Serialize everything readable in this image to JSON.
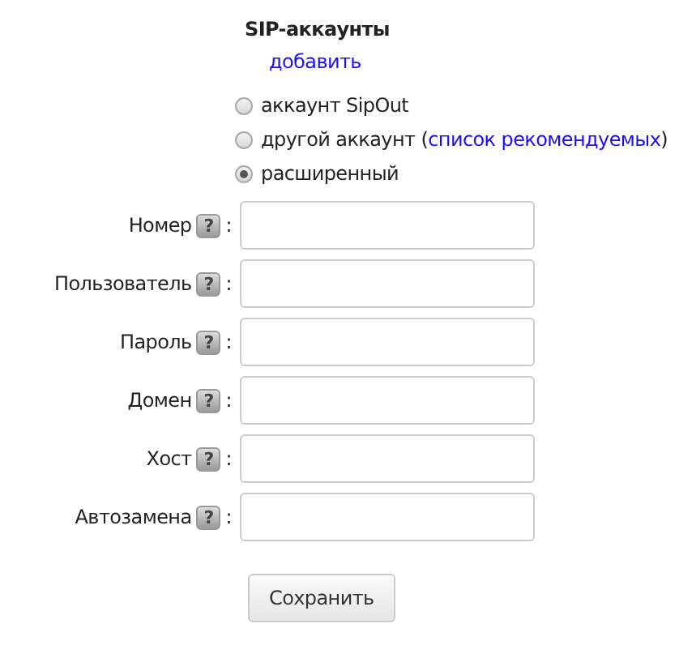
{
  "title": "SIP-аккаунты",
  "add_link": "добавить",
  "account_types": [
    {
      "label": "аккаунт SipOut",
      "selected": false
    },
    {
      "label": "другой аккаунт (",
      "link": "список рекомендуемых",
      "suffix": ")",
      "selected": false
    },
    {
      "label": "расширенный",
      "selected": true
    }
  ],
  "fields": [
    {
      "label": "Номер",
      "help": "?",
      "colon": ":"
    },
    {
      "label": "Пользователь",
      "help": "?",
      "colon": ":"
    },
    {
      "label": "Пароль",
      "help": "?",
      "colon": ":"
    },
    {
      "label": "Домен",
      "help": "?",
      "colon": ":"
    },
    {
      "label": "Хост",
      "help": "?",
      "colon": ":"
    },
    {
      "label": "Автозамена",
      "help": "?",
      "colon": ":"
    }
  ],
  "save_button": "Сохранить"
}
